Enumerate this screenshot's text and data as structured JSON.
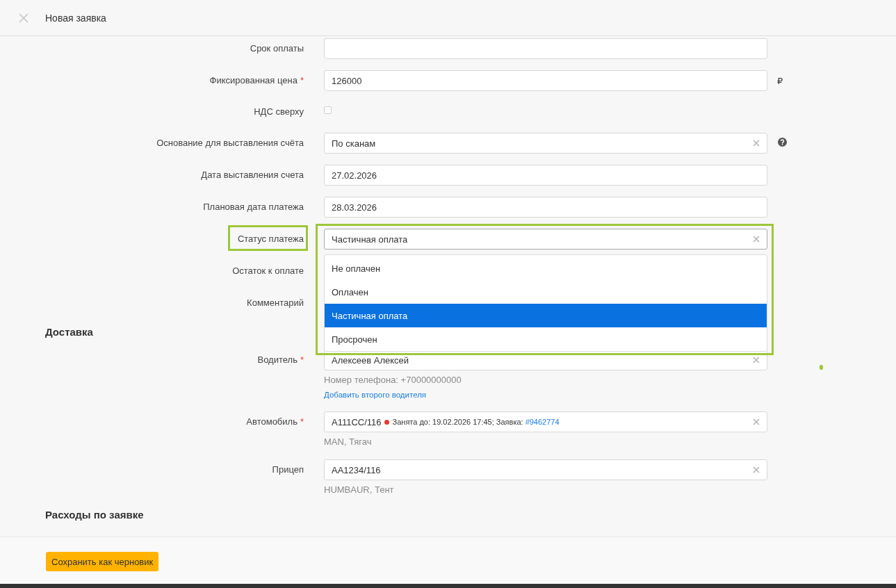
{
  "header": {
    "title": "Новая заявка"
  },
  "payment_fields": [
    {
      "kind": "input",
      "label": "Срок оплаты"
    },
    {
      "kind": "input",
      "label": "Фиксированная цена",
      "required_mark": "*",
      "value": "126000",
      "suffix": "₽"
    },
    {
      "kind": "checkbox",
      "label": "НДС сверху",
      "checked": false
    },
    {
      "kind": "select",
      "label": "Основание для выставления счёта",
      "value": "По сканам",
      "clearable": true,
      "help": true
    },
    {
      "kind": "input",
      "label": "Дата выставления счета",
      "value": "27.02.2026"
    },
    {
      "kind": "input",
      "label": "Плановая дата платежа",
      "value": "28.03.2026"
    },
    {
      "kind": "select",
      "label": "Статус платежа",
      "value": "Частичная оплата",
      "clearable": true,
      "highlighted": true,
      "expanded": true,
      "options": [
        {
          "label": "Не оплачен",
          "selected": false
        },
        {
          "label": "Оплачен",
          "selected": false
        },
        {
          "label": "Частичная оплата",
          "selected": true
        },
        {
          "label": "Просрочен",
          "selected": false
        }
      ]
    },
    {
      "kind": "covered",
      "label": "Остаток к оплате"
    },
    {
      "kind": "covered",
      "label": "Комментарий"
    }
  ],
  "delivery": {
    "title": "Доставка",
    "fields": [
      {
        "kind": "select",
        "label": "Водитель",
        "required_mark": "*",
        "value": "Алексеев Алексей",
        "clearable": true,
        "hints": [
          {
            "kind": "text",
            "text": "Номер телефона: +70000000000"
          },
          {
            "kind": "link",
            "text": "Добавить второго водителя"
          }
        ]
      },
      {
        "kind": "vehicle",
        "label": "Автомобиль",
        "required_mark": "*",
        "value": "А111СС/116",
        "clearable": true,
        "status": {
          "color": "#e53935",
          "text": "Занята до: 19.02.2026 17:45; Заявка:",
          "link": "#9462774"
        },
        "hints": [
          {
            "kind": "text",
            "text": "MAN, Тягач"
          }
        ]
      },
      {
        "kind": "select",
        "label": "Прицеп",
        "value": "АА1234/116",
        "clearable": true,
        "hints": [
          {
            "kind": "text",
            "text": "HUMBAUR, Тент"
          }
        ]
      }
    ]
  },
  "expenses": {
    "title": "Расходы по заявке"
  },
  "footer": {
    "buttons": [
      {
        "label": "Сохранить как черновик"
      }
    ]
  }
}
